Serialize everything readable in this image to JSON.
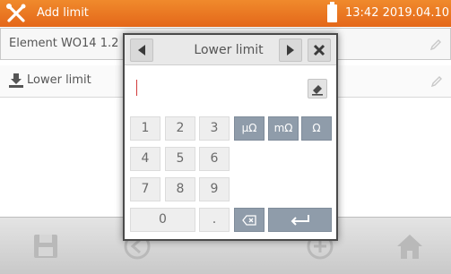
{
  "titlebar": {
    "title": "Add limit",
    "clock": "13:42 2019.04.10",
    "icon": "wrench-screwdriver-icon"
  },
  "rows": {
    "element_label": "Element WO14 1.2",
    "lower_limit_label": "Lower limit"
  },
  "dialog": {
    "title": "Lower limit",
    "input_value": "",
    "keys": {
      "k1": "1",
      "k2": "2",
      "k3": "3",
      "k4": "4",
      "k5": "5",
      "k6": "6",
      "k7": "7",
      "k8": "8",
      "k9": "9",
      "k0": "0",
      "dot": ".",
      "unit_micro": "µΩ",
      "unit_milli": "mΩ",
      "unit_ohm": "Ω"
    }
  },
  "colors": {
    "titlebar": "#e97624",
    "unit_key": "#8f9caa"
  }
}
